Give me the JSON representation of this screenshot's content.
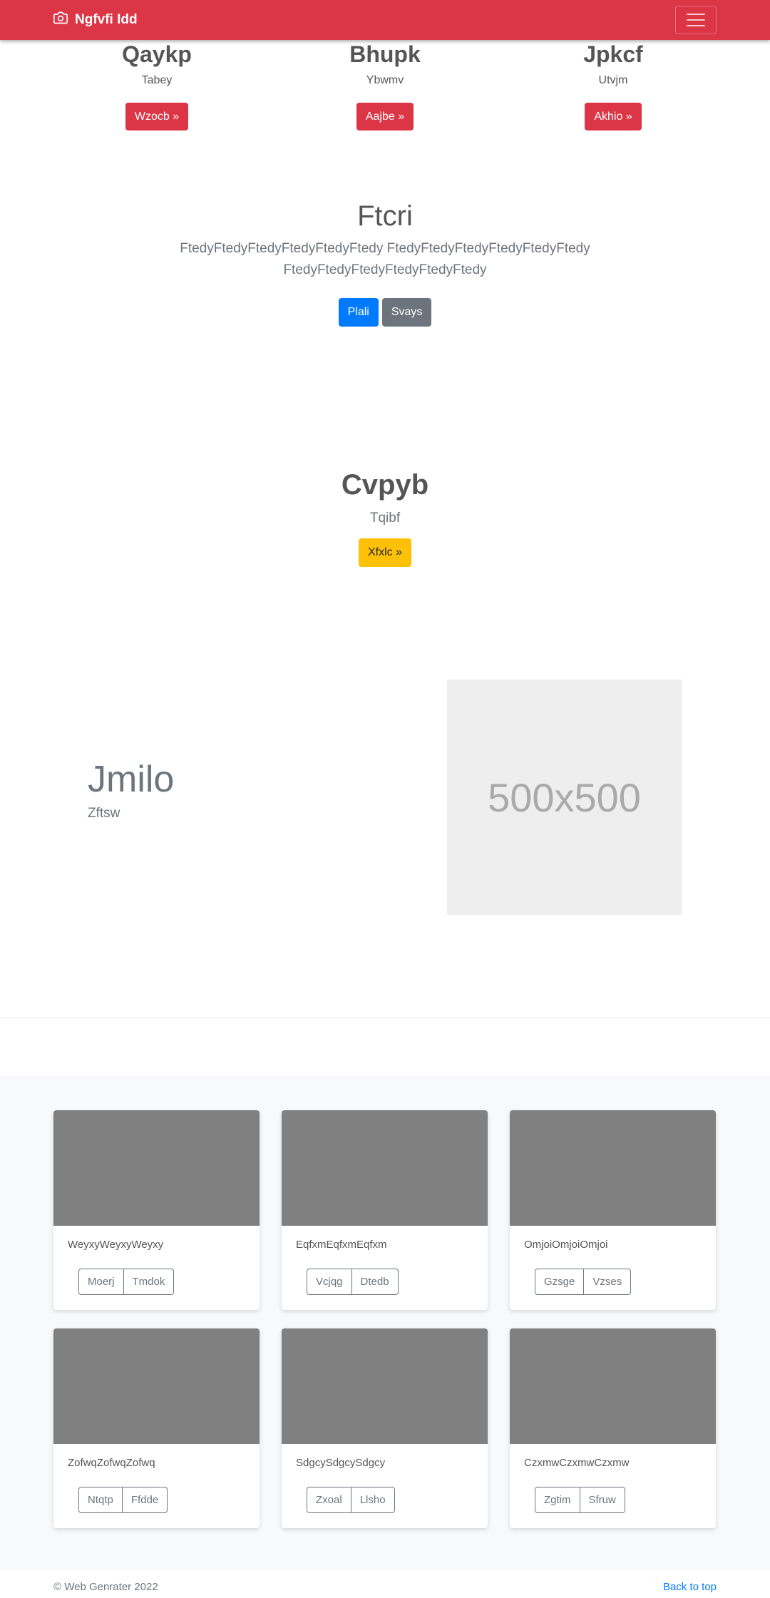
{
  "navbar": {
    "brand": "Ngfvfi Idd"
  },
  "columns": [
    {
      "title": "Qaykp",
      "text": "Tabey",
      "button": "Wzocb »"
    },
    {
      "title": "Bhupk",
      "text": "Ybwmv",
      "button": "Aajbe »"
    },
    {
      "title": "Jpkcf",
      "text": "Utvjm",
      "button": "Akhio »"
    }
  ],
  "hero": {
    "title": "Ftcri",
    "lead": "FtedyFtedyFtedyFtedyFtedyFtedy FtedyFtedyFtedyFtedyFtedyFtedy FtedyFtedyFtedyFtedyFtedyFtedy",
    "primary_button": "Plali",
    "secondary_button": "Svays"
  },
  "feature": {
    "title": "Cvpyb",
    "text": "Tqibf",
    "button": "Xfxlc »"
  },
  "split": {
    "title": "Jmilo",
    "text": "Zftsw",
    "placeholder": "500x500"
  },
  "cards": [
    {
      "text": "WeyxyWeyxyWeyxy",
      "btn1": "Moerj",
      "btn2": "Tmdok"
    },
    {
      "text": "EqfxmEqfxmEqfxm",
      "btn1": "Vcjqg",
      "btn2": "Dtedb"
    },
    {
      "text": "OmjoiOmjoiOmjoi",
      "btn1": "Gzsge",
      "btn2": "Vzses"
    },
    {
      "text": "ZofwqZofwqZofwq",
      "btn1": "Ntqtp",
      "btn2": "Ffdde"
    },
    {
      "text": "SdgcySdgcySdgcy",
      "btn1": "Zxoal",
      "btn2": "Llsho"
    },
    {
      "text": "CzxmwCzxmwCzxmw",
      "btn1": "Zgtim",
      "btn2": "Sfruw"
    }
  ],
  "footer": {
    "copyright": "© Web Genrater 2022",
    "back_to_top": "Back to top"
  }
}
